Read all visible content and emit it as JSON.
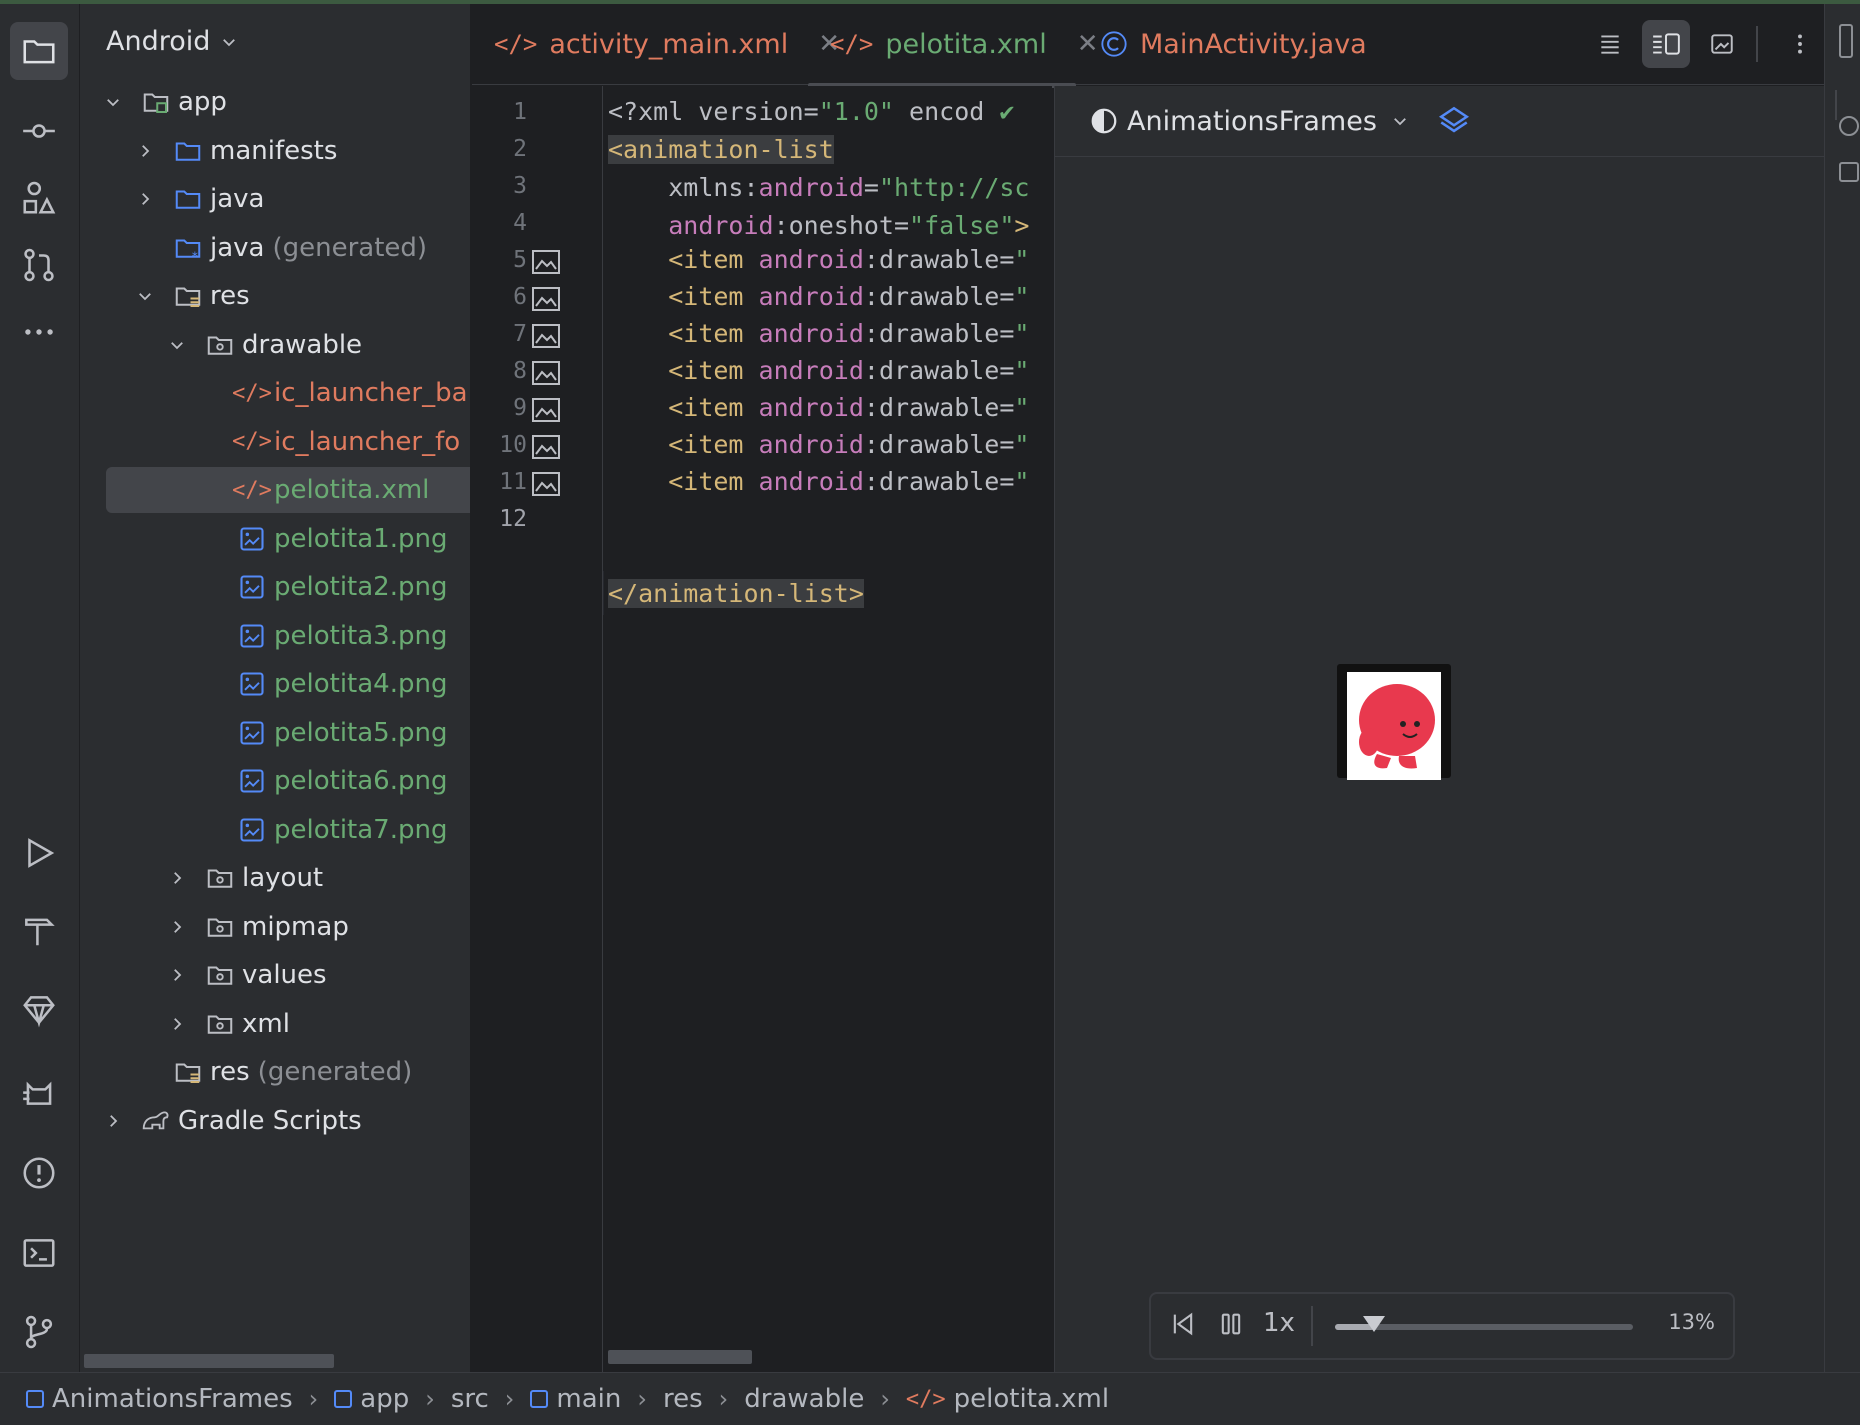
{
  "project": {
    "view_label": "Android",
    "tree": [
      {
        "label": "app",
        "suffix": "",
        "color": "#dfe1e5"
      },
      {
        "label": "manifests",
        "suffix": "",
        "color": "#dfe1e5"
      },
      {
        "label": "java",
        "suffix": "",
        "color": "#dfe1e5"
      },
      {
        "label": "java",
        "suffix": "(generated)",
        "color": "#dfe1e5"
      },
      {
        "label": "res",
        "suffix": "",
        "color": "#dfe1e5"
      },
      {
        "label": "drawable",
        "suffix": "",
        "color": "#dfe1e5"
      },
      {
        "label": "ic_launcher_ba",
        "suffix": "",
        "color": "#e07b5f"
      },
      {
        "label": "ic_launcher_fo",
        "suffix": "",
        "color": "#e07b5f"
      },
      {
        "label": "pelotita.xml",
        "suffix": "",
        "color": "#6aab73"
      },
      {
        "label": "pelotita1.png",
        "suffix": "",
        "color": "#6aab73"
      },
      {
        "label": "pelotita2.png",
        "suffix": "",
        "color": "#6aab73"
      },
      {
        "label": "pelotita3.png",
        "suffix": "",
        "color": "#6aab73"
      },
      {
        "label": "pelotita4.png",
        "suffix": "",
        "color": "#6aab73"
      },
      {
        "label": "pelotita5.png",
        "suffix": "",
        "color": "#6aab73"
      },
      {
        "label": "pelotita6.png",
        "suffix": "",
        "color": "#6aab73"
      },
      {
        "label": "pelotita7.png",
        "suffix": "",
        "color": "#6aab73"
      },
      {
        "label": "layout",
        "suffix": "",
        "color": "#dfe1e5"
      },
      {
        "label": "mipmap",
        "suffix": "",
        "color": "#dfe1e5"
      },
      {
        "label": "values",
        "suffix": "",
        "color": "#dfe1e5"
      },
      {
        "label": "xml",
        "suffix": "",
        "color": "#dfe1e5"
      },
      {
        "label": "res",
        "suffix": "(generated)",
        "color": "#dfe1e5"
      },
      {
        "label": "Gradle Scripts",
        "suffix": "",
        "color": "#dfe1e5"
      }
    ]
  },
  "tabs": [
    {
      "label": "activity_main.xml",
      "color": "#e07b5f",
      "icon": "xml-icon"
    },
    {
      "label": "pelotita.xml",
      "color": "#6aab73",
      "icon": "xml-icon",
      "active": true
    },
    {
      "label": "MainActivity.java",
      "color": "#e07b5f",
      "icon": "class-icon"
    }
  ],
  "editor": {
    "line_numbers": [
      "1",
      "2",
      "3",
      "4",
      "5",
      "6",
      "7",
      "8",
      "9",
      "10",
      "11",
      "12"
    ],
    "current_line": "12",
    "lines": {
      "l1": {
        "a": "<?xml version=",
        "b": "\"1.0\"",
        "c": " encod"
      },
      "l2": {
        "a": "<animation-list"
      },
      "l3": {
        "a": "xmlns",
        "b": ":",
        "c": "android",
        "d": "=",
        "e": "\"http://sc"
      },
      "l4": {
        "a": "android",
        "b": ":oneshot=",
        "c": "\"false\"",
        "d": ">"
      },
      "item": {
        "a": "<item ",
        "b": "android",
        "c": ":drawable=",
        "d": "\""
      },
      "l12": {
        "a": "</animation-list>"
      }
    }
  },
  "preview": {
    "config_label": "AnimationsFrames",
    "speed": "1x",
    "progress_label": "13%",
    "progress": 0.13
  },
  "breadcrumb": [
    "AnimationsFrames",
    "app",
    "src",
    "main",
    "res",
    "drawable",
    "pelotita.xml"
  ],
  "colors": {
    "accent": "#548af7",
    "xml_orange": "#e07b5f",
    "added_green": "#6aab73",
    "bg": "#1e1f22",
    "panel": "#2b2d30"
  }
}
